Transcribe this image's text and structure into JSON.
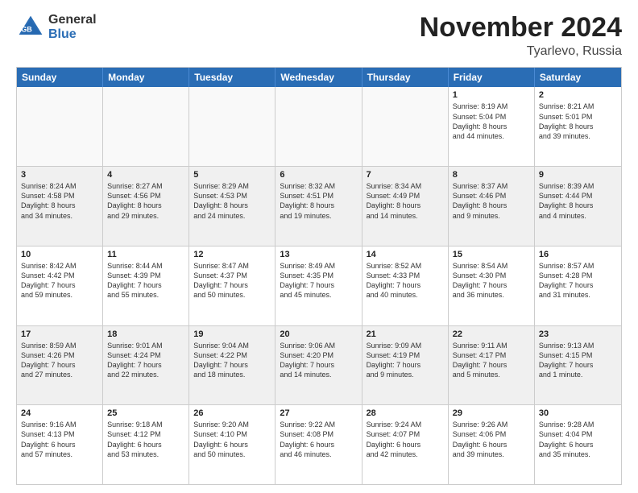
{
  "header": {
    "logo_general": "General",
    "logo_blue": "Blue",
    "month_title": "November 2024",
    "location": "Tyarlevo, Russia"
  },
  "calendar": {
    "days": [
      "Sunday",
      "Monday",
      "Tuesday",
      "Wednesday",
      "Thursday",
      "Friday",
      "Saturday"
    ],
    "rows": [
      [
        {
          "day": "",
          "text": "",
          "empty": true
        },
        {
          "day": "",
          "text": "",
          "empty": true
        },
        {
          "day": "",
          "text": "",
          "empty": true
        },
        {
          "day": "",
          "text": "",
          "empty": true
        },
        {
          "day": "",
          "text": "",
          "empty": true
        },
        {
          "day": "1",
          "text": "Sunrise: 8:19 AM\nSunset: 5:04 PM\nDaylight: 8 hours\nand 44 minutes.",
          "empty": false
        },
        {
          "day": "2",
          "text": "Sunrise: 8:21 AM\nSunset: 5:01 PM\nDaylight: 8 hours\nand 39 minutes.",
          "empty": false
        }
      ],
      [
        {
          "day": "3",
          "text": "Sunrise: 8:24 AM\nSunset: 4:58 PM\nDaylight: 8 hours\nand 34 minutes.",
          "empty": false
        },
        {
          "day": "4",
          "text": "Sunrise: 8:27 AM\nSunset: 4:56 PM\nDaylight: 8 hours\nand 29 minutes.",
          "empty": false
        },
        {
          "day": "5",
          "text": "Sunrise: 8:29 AM\nSunset: 4:53 PM\nDaylight: 8 hours\nand 24 minutes.",
          "empty": false
        },
        {
          "day": "6",
          "text": "Sunrise: 8:32 AM\nSunset: 4:51 PM\nDaylight: 8 hours\nand 19 minutes.",
          "empty": false
        },
        {
          "day": "7",
          "text": "Sunrise: 8:34 AM\nSunset: 4:49 PM\nDaylight: 8 hours\nand 14 minutes.",
          "empty": false
        },
        {
          "day": "8",
          "text": "Sunrise: 8:37 AM\nSunset: 4:46 PM\nDaylight: 8 hours\nand 9 minutes.",
          "empty": false
        },
        {
          "day": "9",
          "text": "Sunrise: 8:39 AM\nSunset: 4:44 PM\nDaylight: 8 hours\nand 4 minutes.",
          "empty": false
        }
      ],
      [
        {
          "day": "10",
          "text": "Sunrise: 8:42 AM\nSunset: 4:42 PM\nDaylight: 7 hours\nand 59 minutes.",
          "empty": false
        },
        {
          "day": "11",
          "text": "Sunrise: 8:44 AM\nSunset: 4:39 PM\nDaylight: 7 hours\nand 55 minutes.",
          "empty": false
        },
        {
          "day": "12",
          "text": "Sunrise: 8:47 AM\nSunset: 4:37 PM\nDaylight: 7 hours\nand 50 minutes.",
          "empty": false
        },
        {
          "day": "13",
          "text": "Sunrise: 8:49 AM\nSunset: 4:35 PM\nDaylight: 7 hours\nand 45 minutes.",
          "empty": false
        },
        {
          "day": "14",
          "text": "Sunrise: 8:52 AM\nSunset: 4:33 PM\nDaylight: 7 hours\nand 40 minutes.",
          "empty": false
        },
        {
          "day": "15",
          "text": "Sunrise: 8:54 AM\nSunset: 4:30 PM\nDaylight: 7 hours\nand 36 minutes.",
          "empty": false
        },
        {
          "day": "16",
          "text": "Sunrise: 8:57 AM\nSunset: 4:28 PM\nDaylight: 7 hours\nand 31 minutes.",
          "empty": false
        }
      ],
      [
        {
          "day": "17",
          "text": "Sunrise: 8:59 AM\nSunset: 4:26 PM\nDaylight: 7 hours\nand 27 minutes.",
          "empty": false
        },
        {
          "day": "18",
          "text": "Sunrise: 9:01 AM\nSunset: 4:24 PM\nDaylight: 7 hours\nand 22 minutes.",
          "empty": false
        },
        {
          "day": "19",
          "text": "Sunrise: 9:04 AM\nSunset: 4:22 PM\nDaylight: 7 hours\nand 18 minutes.",
          "empty": false
        },
        {
          "day": "20",
          "text": "Sunrise: 9:06 AM\nSunset: 4:20 PM\nDaylight: 7 hours\nand 14 minutes.",
          "empty": false
        },
        {
          "day": "21",
          "text": "Sunrise: 9:09 AM\nSunset: 4:19 PM\nDaylight: 7 hours\nand 9 minutes.",
          "empty": false
        },
        {
          "day": "22",
          "text": "Sunrise: 9:11 AM\nSunset: 4:17 PM\nDaylight: 7 hours\nand 5 minutes.",
          "empty": false
        },
        {
          "day": "23",
          "text": "Sunrise: 9:13 AM\nSunset: 4:15 PM\nDaylight: 7 hours\nand 1 minute.",
          "empty": false
        }
      ],
      [
        {
          "day": "24",
          "text": "Sunrise: 9:16 AM\nSunset: 4:13 PM\nDaylight: 6 hours\nand 57 minutes.",
          "empty": false
        },
        {
          "day": "25",
          "text": "Sunrise: 9:18 AM\nSunset: 4:12 PM\nDaylight: 6 hours\nand 53 minutes.",
          "empty": false
        },
        {
          "day": "26",
          "text": "Sunrise: 9:20 AM\nSunset: 4:10 PM\nDaylight: 6 hours\nand 50 minutes.",
          "empty": false
        },
        {
          "day": "27",
          "text": "Sunrise: 9:22 AM\nSunset: 4:08 PM\nDaylight: 6 hours\nand 46 minutes.",
          "empty": false
        },
        {
          "day": "28",
          "text": "Sunrise: 9:24 AM\nSunset: 4:07 PM\nDaylight: 6 hours\nand 42 minutes.",
          "empty": false
        },
        {
          "day": "29",
          "text": "Sunrise: 9:26 AM\nSunset: 4:06 PM\nDaylight: 6 hours\nand 39 minutes.",
          "empty": false
        },
        {
          "day": "30",
          "text": "Sunrise: 9:28 AM\nSunset: 4:04 PM\nDaylight: 6 hours\nand 35 minutes.",
          "empty": false
        }
      ]
    ]
  }
}
